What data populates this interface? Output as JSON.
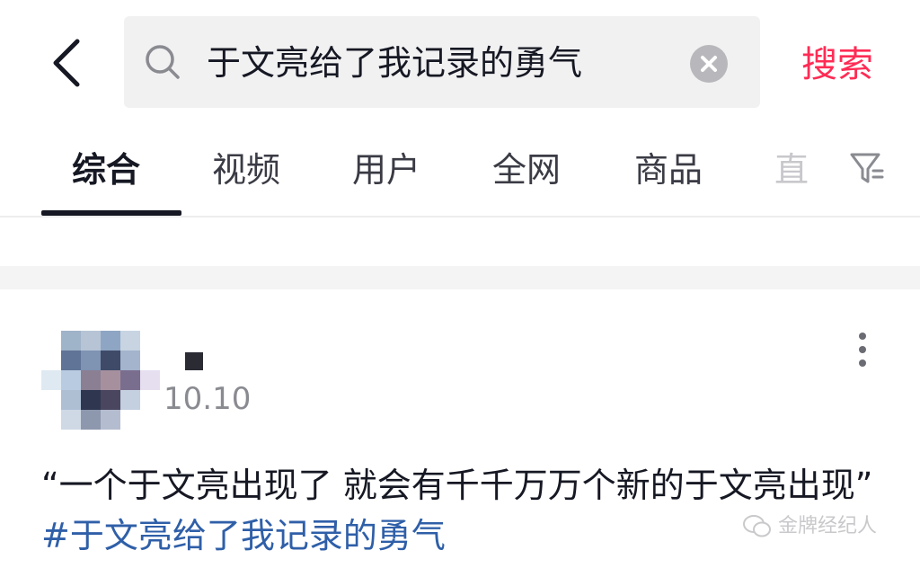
{
  "search": {
    "query": "于文亮给了我记录的勇气",
    "submit_label": "搜索"
  },
  "tabs": [
    {
      "label": "综合",
      "active": true
    },
    {
      "label": "视频",
      "active": false
    },
    {
      "label": "用户",
      "active": false
    },
    {
      "label": "全网",
      "active": false
    },
    {
      "label": "商品",
      "active": false
    },
    {
      "label": "直",
      "active": false
    }
  ],
  "post": {
    "date": "10.10",
    "text": "“一个于文亮出现了 就会有千千万万个新的于文亮出现”",
    "hashtag": "#于文亮给了我记录的勇气"
  },
  "watermark": {
    "text": "金牌经纪人"
  },
  "colors": {
    "accent": "#fe2c55",
    "hashtag": "#2f5fa8",
    "text": "#161823"
  }
}
